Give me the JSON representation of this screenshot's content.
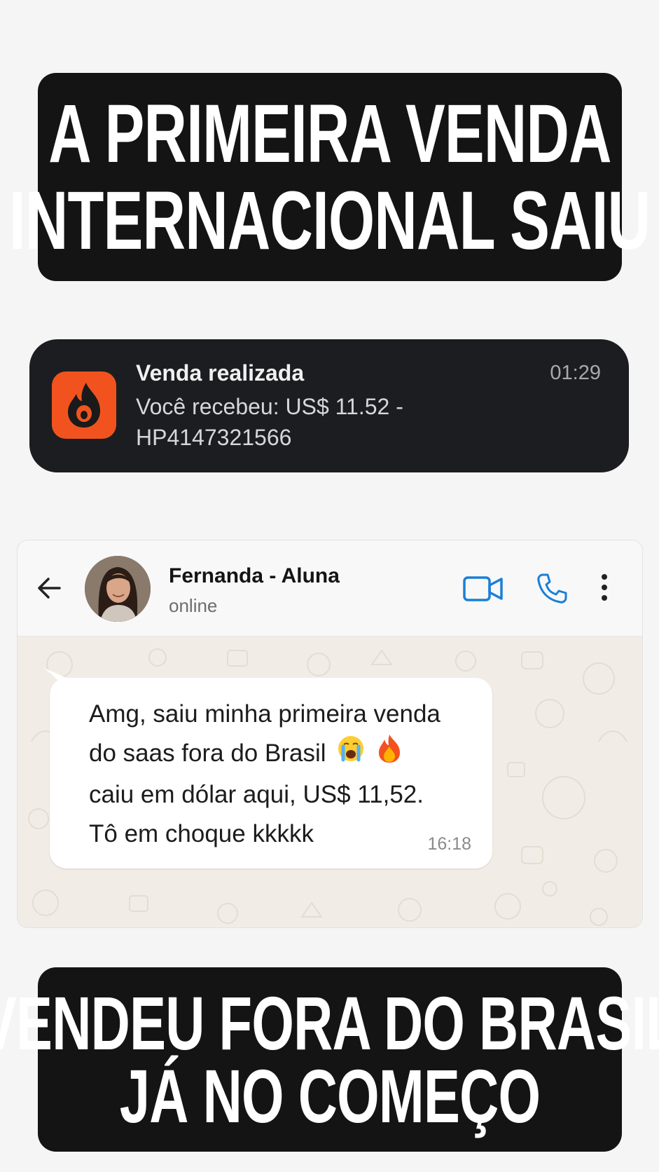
{
  "headline_top": {
    "line1": "A PRIMEIRA VENDA",
    "line2": "INTERNACIONAL SAIU"
  },
  "notification": {
    "app_icon": "flame-icon",
    "title": "Venda realizada",
    "time": "01:29",
    "body_line1": "Você recebeu: US$ 11.52 -",
    "body_line2": "HP4147321566"
  },
  "chat": {
    "contact_name": "Fernanda - Aluna",
    "status": "online",
    "icons": [
      "back-arrow-icon",
      "avatar",
      "video-call-icon",
      "phone-icon",
      "more-vertical-icon"
    ],
    "accent_color": "#1a7fd6",
    "message": {
      "line1": "Amg, saiu minha primeira venda",
      "line2": "do saas fora do Brasil",
      "line2_emojis": [
        "crying-face-emoji",
        "fire-emoji"
      ],
      "line3": "caiu em dólar aqui, US$ 11,52.",
      "line4": "Tô em choque kkkkk",
      "time": "16:18"
    }
  },
  "headline_bottom": {
    "line1": "VENDEU FORA DO BRASIL",
    "line2": "JÁ NO COMEÇO"
  }
}
